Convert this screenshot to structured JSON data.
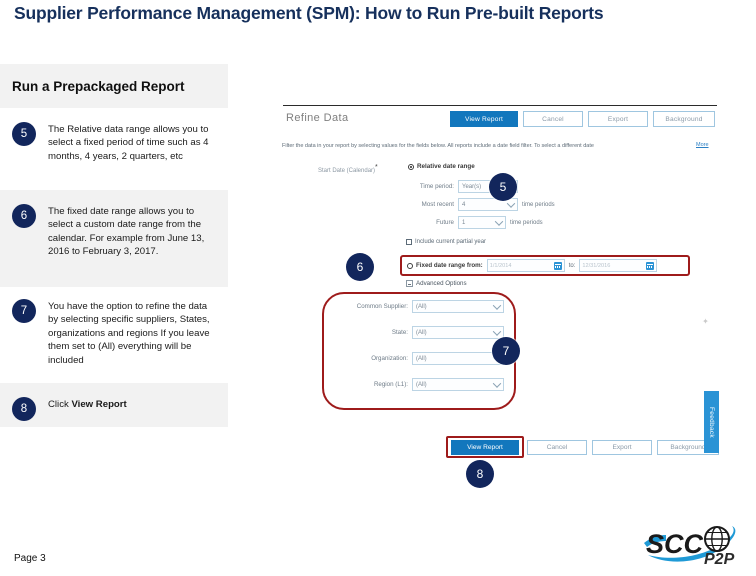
{
  "slide": {
    "title": "Supplier Performance Management (SPM): How to Run Pre-built Reports",
    "page_number": "Page 3",
    "accent_navy": "#12265c",
    "accent_blue": "#1277bd",
    "highlight_red": "#9e1b1b"
  },
  "steps_table": {
    "header": "Run a Prepackaged Report",
    "rows": [
      {
        "number": "5",
        "text": "The Relative data range allows you to select a fixed period of time such as 4 months, 4 years, 2 quarters, etc"
      },
      {
        "number": "6",
        "text": "The fixed date range allows you to select a custom date range from the calendar.  For example from June 13, 2016 to February 3, 2017."
      },
      {
        "number": "7",
        "text": "You have the option to refine the data by selecting specific suppliers, States, organizations and regions  If you leave them set to (All) everything will be included"
      },
      {
        "number": "8",
        "text_prefix": "Click ",
        "text_bold": "View Report"
      }
    ]
  },
  "app_screenshot": {
    "panel_title": "Refine Data",
    "top_buttons": [
      {
        "label": "View Report",
        "style": "primary"
      },
      {
        "label": "Cancel",
        "style": "ghost"
      },
      {
        "label": "Export",
        "style": "ghost"
      },
      {
        "label": "Background",
        "style": "ghost"
      }
    ],
    "filter_description": "Filter the data in your report by selecting values for the fields below. All reports include a date field filter. To select a different date",
    "more_link": "More",
    "start_date_label": "Start Date (Calendar)",
    "required_marker": "*",
    "relative_range_option": "Relative date range",
    "relative_fields": [
      {
        "label": "Time period:",
        "value": "Year(s)",
        "suffix": ""
      },
      {
        "label": "Most recent",
        "value": "4",
        "suffix": "time periods"
      },
      {
        "label": "Future",
        "value": "1",
        "suffix": "time periods"
      }
    ],
    "include_partial_label": "Include current partial year",
    "fixed_range": {
      "option_label": "Fixed date range from:",
      "from_value": "1/1/2014",
      "to_word": "to:",
      "to_value": "12/31/2016"
    },
    "advanced_options_label": "Advanced Options",
    "refine_fields": [
      {
        "label": "Common Supplier:",
        "value": "(All)"
      },
      {
        "label": "State:",
        "value": "(All)"
      },
      {
        "label": "Organization:",
        "value": "(All)"
      },
      {
        "label": "Region (L1):",
        "value": "(All)"
      }
    ],
    "bottom_buttons": [
      {
        "label": "View Report",
        "style": "primary"
      },
      {
        "label": "Cancel",
        "style": "ghost"
      },
      {
        "label": "Export",
        "style": "ghost"
      },
      {
        "label": "Background",
        "style": "ghost"
      }
    ],
    "feedback_tab": "Feedback"
  },
  "callouts": [
    {
      "number": "5"
    },
    {
      "number": "6"
    },
    {
      "number": "7"
    },
    {
      "number": "8"
    }
  ],
  "logo": {
    "wordmark": "SCC",
    "subtext": "P2P"
  }
}
